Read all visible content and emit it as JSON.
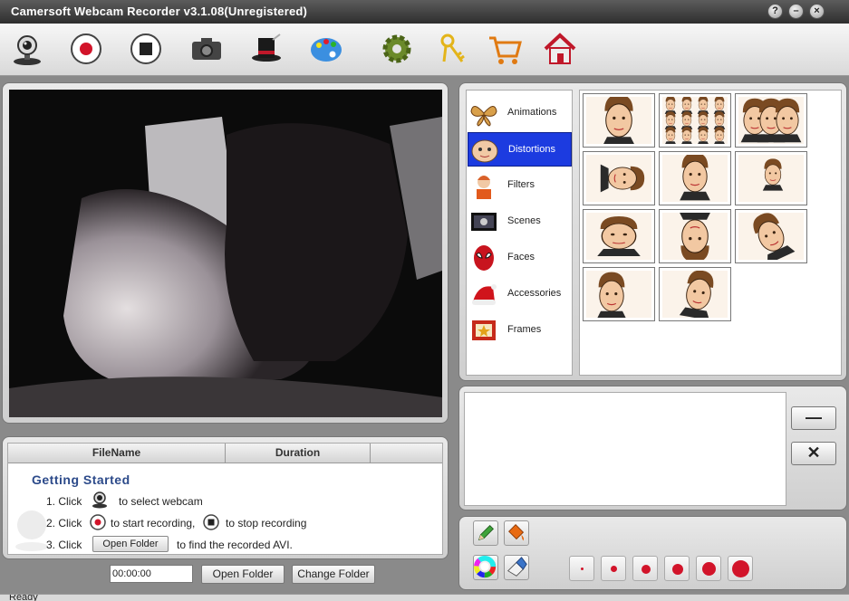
{
  "window": {
    "title": "Camersoft Webcam Recorder v3.1.08(Unregistered)",
    "controls": [
      "help-icon",
      "minimize-icon",
      "close-icon"
    ]
  },
  "toolbar": {
    "icons": [
      "webcam-icon",
      "record-icon",
      "stop-icon",
      "camera-icon",
      "magic-hat-icon",
      "palette-icon",
      "gear-icon",
      "keys-icon",
      "cart-icon",
      "home-icon"
    ]
  },
  "effects": {
    "categories": [
      {
        "label": "Animations",
        "icon": "butterfly-icon"
      },
      {
        "label": "Distortions",
        "icon": "face-distort-icon",
        "selected": true
      },
      {
        "label": "Filters",
        "icon": "filter-face-icon"
      },
      {
        "label": "Scenes",
        "icon": "scenes-icon"
      },
      {
        "label": "Faces",
        "icon": "spiderman-mask-icon"
      },
      {
        "label": "Accessories",
        "icon": "santa-hat-icon"
      },
      {
        "label": "Frames",
        "icon": "frame-star-icon"
      }
    ],
    "thumbnail_count": 11
  },
  "effect_list": {
    "remove_label": "—",
    "clear_label": "✕"
  },
  "recordings": {
    "columns": [
      "FileName",
      "Duration"
    ],
    "getting_started_title": "Getting  Started",
    "step1_num": "1. Click",
    "step1_text": "to select webcam",
    "step2_num": "2. Click",
    "step2_text_a": "to start recording,",
    "step2_text_b": "to stop recording",
    "step3_num": "3. Click",
    "step3_button": "Open Folder",
    "step3_text": "to find the recorded AVI."
  },
  "bottom": {
    "time": "00:00:00",
    "open_folder": "Open Folder",
    "change_folder": "Change Folder"
  },
  "draw_tools": {
    "icons": [
      "pencil-icon",
      "paint-bucket-icon",
      "color-wheel-icon",
      "eraser-icon"
    ],
    "brush_sizes": [
      1,
      2,
      3,
      4,
      5,
      6
    ]
  },
  "colors": {
    "selected_category": "#1c3be0",
    "record_red": "#d2142a",
    "title_bar": "#3a3a3a"
  },
  "status": {
    "text": "Ready"
  }
}
